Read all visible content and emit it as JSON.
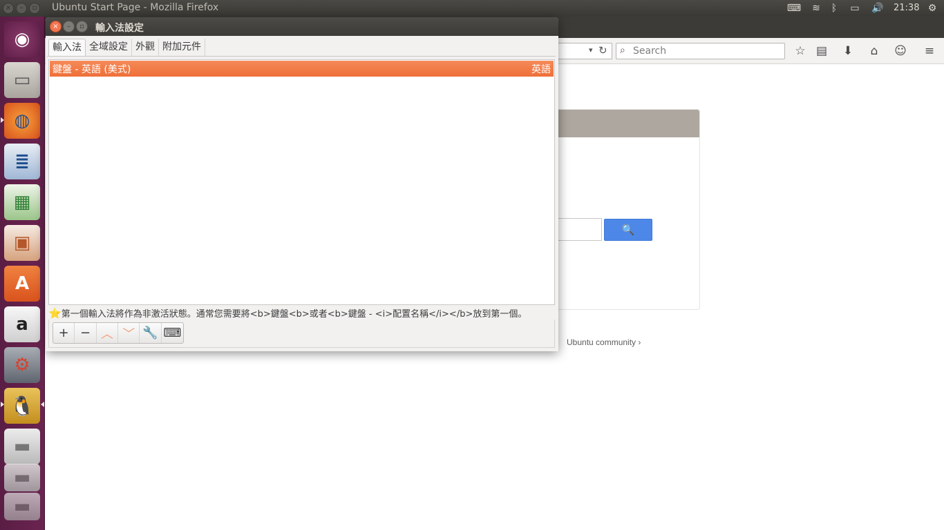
{
  "top_panel": {
    "window_title": "Ubuntu Start Page - Mozilla Firefox",
    "clock": "21:38",
    "tray_icons": [
      "keyboard-icon",
      "wifi-icon",
      "bluetooth-icon",
      "battery-icon",
      "volume-icon",
      "gear-icon"
    ]
  },
  "launcher": {
    "items": [
      {
        "name": "ubuntu-dash",
        "glyph": "◉"
      },
      {
        "name": "files",
        "glyph": "▭"
      },
      {
        "name": "firefox",
        "glyph": "◍"
      },
      {
        "name": "libreoffice-writer",
        "glyph": "≣"
      },
      {
        "name": "libreoffice-calc",
        "glyph": "▦"
      },
      {
        "name": "libreoffice-impress",
        "glyph": "▣"
      },
      {
        "name": "ubuntu-software",
        "glyph": "A"
      },
      {
        "name": "amazon",
        "glyph": "a"
      },
      {
        "name": "system-settings",
        "glyph": "⚙"
      },
      {
        "name": "fcitx-config",
        "glyph": "🐧"
      },
      {
        "name": "drive-1",
        "glyph": "▬"
      },
      {
        "name": "drive-2",
        "glyph": "▬"
      }
    ]
  },
  "firefox": {
    "search_placeholder": "Search",
    "start_search_button": "🔍",
    "community_link": "Ubuntu community ›"
  },
  "dialog": {
    "title": "輸入法設定",
    "tabs": [
      "輸入法",
      "全域設定",
      "外觀",
      "附加元件"
    ],
    "active_tab": 0,
    "input_methods": [
      {
        "name": "鍵盤 - 英語 (美式)",
        "language": "英語"
      }
    ],
    "hint_star": "⭐",
    "hint": "第一個輸入法將作為非激活狀態。通常您需要將<b>鍵盤<b>或者<b>鍵盤 - <i>配置名稱</i></b>放到第一個。",
    "toolbar": {
      "add": "+",
      "remove": "−",
      "up": "︿",
      "down": "﹀",
      "configure": "🔧",
      "keyboard": "⌨"
    }
  }
}
